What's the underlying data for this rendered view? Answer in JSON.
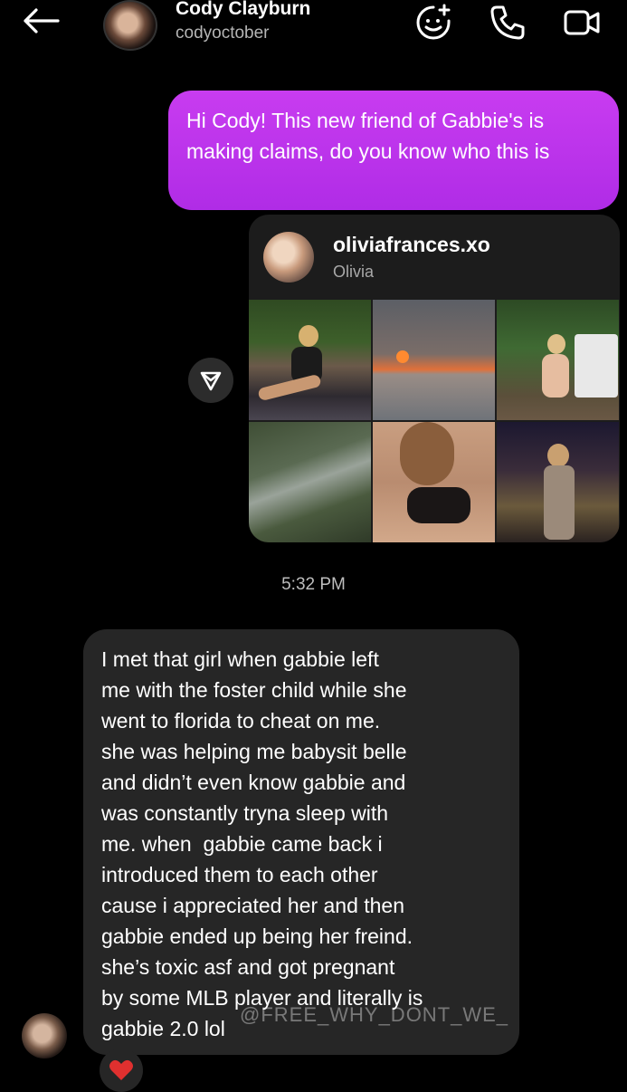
{
  "header": {
    "name": "Cody Clayburn",
    "username": "codyoctober",
    "icons": [
      "back-arrow-icon",
      "sticker-add-icon",
      "phone-icon",
      "video-icon"
    ]
  },
  "messages": {
    "outgoing_1": "Hi Cody! This new friend of Gabbie's is making claims, do you know who this is",
    "shared_profile": {
      "username": "oliviafrances.xo",
      "display_name": "Olivia",
      "thumbnail_count": 6
    },
    "timestamp": "5:32 PM",
    "incoming_1_lines": [
      "I met that girl when gabbie left",
      "me with the foster child while she",
      "went to florida to cheat on me.",
      "she was helping me babysit belle",
      "and didn’t even know gabbie and",
      "was constantly tryna sleep with",
      "me. when  gabbie came back i",
      "introduced them to each other",
      "cause i appreciated her and then",
      "gabbie ended up being her freind.",
      "she’s toxic asf and got pregnant",
      "by some MLB player and literally is",
      "gabbie 2.0 lol"
    ],
    "reaction": "heart"
  },
  "watermark": "@FREE_WHY_DONT_WE_",
  "colors": {
    "background": "#000000",
    "outgoing_bubble": "#b52ee8",
    "incoming_bubble": "#262626",
    "reaction_heart": "#e0302f"
  }
}
